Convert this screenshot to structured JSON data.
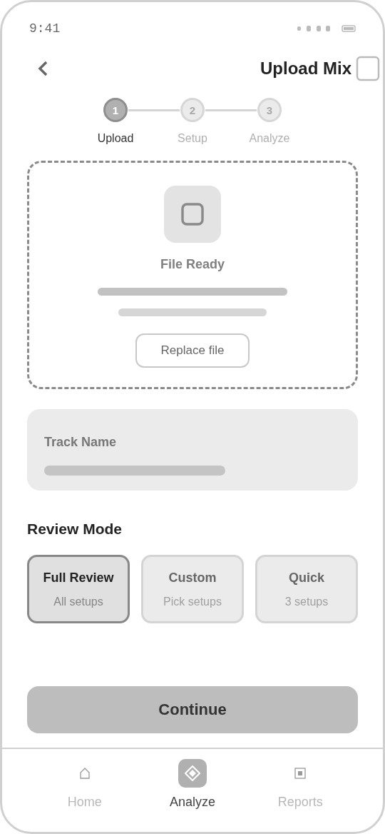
{
  "status_bar": {
    "time": "9:41"
  },
  "header": {
    "title": "Upload Mix"
  },
  "steps": [
    {
      "number": "1",
      "label": "Upload",
      "selected": true
    },
    {
      "number": "2",
      "label": "Setup",
      "selected": false
    },
    {
      "number": "3",
      "label": "Analyze",
      "selected": false
    }
  ],
  "upload": {
    "status": "File Ready",
    "button": "Replace file"
  },
  "track_name": {
    "label": "Track Name"
  },
  "review_mode": {
    "title": "Review Mode",
    "options": [
      {
        "title": "Full Review",
        "subtitle": "All setups",
        "selected": true
      },
      {
        "title": "Custom",
        "subtitle": "Pick setups",
        "selected": false
      },
      {
        "title": "Quick",
        "subtitle": "3 setups",
        "selected": false
      }
    ]
  },
  "continue_button": "Continue",
  "bottom_nav": [
    {
      "label": "Home",
      "selected": false
    },
    {
      "label": "Analyze",
      "selected": true
    },
    {
      "label": "Reports",
      "selected": false
    }
  ]
}
